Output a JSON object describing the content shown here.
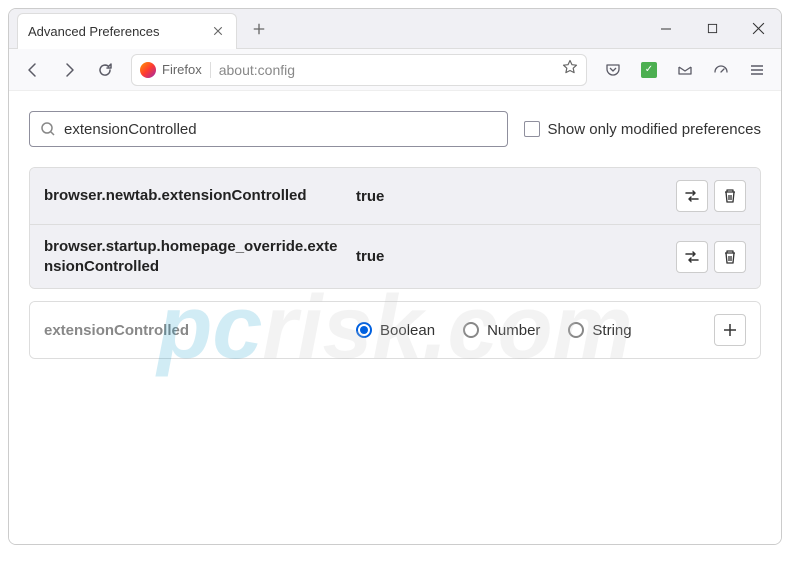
{
  "titlebar": {
    "tab_title": "Advanced Preferences"
  },
  "toolbar": {
    "identity_label": "Firefox",
    "url": "about:config"
  },
  "search": {
    "value": "extensionControlled",
    "modified_label": "Show only modified preferences"
  },
  "prefs": [
    {
      "name": "browser.newtab.extensionControlled",
      "value": "true"
    },
    {
      "name": "browser.startup.homepage_override.extensionControlled",
      "value": "true"
    }
  ],
  "new_pref": {
    "name": "extensionControlled",
    "types": [
      "Boolean",
      "Number",
      "String"
    ],
    "selected": "Boolean"
  },
  "watermark": {
    "pc": "pc",
    "rest": "risk.com"
  }
}
